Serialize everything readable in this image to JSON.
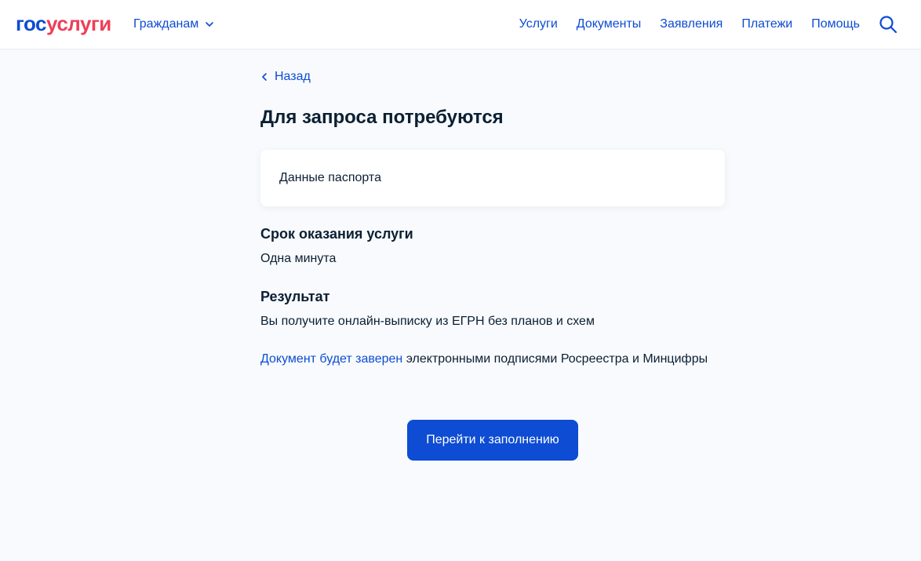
{
  "header": {
    "logo": {
      "part1": "гос",
      "part2": "услуги"
    },
    "audience_label": "Гражданам",
    "nav": [
      "Услуги",
      "Документы",
      "Заявления",
      "Платежи",
      "Помощь"
    ]
  },
  "main": {
    "back_label": "Назад",
    "title": "Для запроса потребуются",
    "required_card": "Данные паспорта",
    "term_heading": "Срок оказания услуги",
    "term_value": "Одна минута",
    "result_heading": "Результат",
    "result_text": "Вы получите онлайн-выписку из ЕГРН без планов и схем",
    "signature_link": "Документ будет заверен",
    "signature_text": " электронными подписями Росреестра и Минцифры",
    "primary_button": "Перейти к заполнению"
  },
  "colors": {
    "accent": "#0d4cd3",
    "brand_red": "#ee3f58",
    "background": "#f8fafd"
  }
}
